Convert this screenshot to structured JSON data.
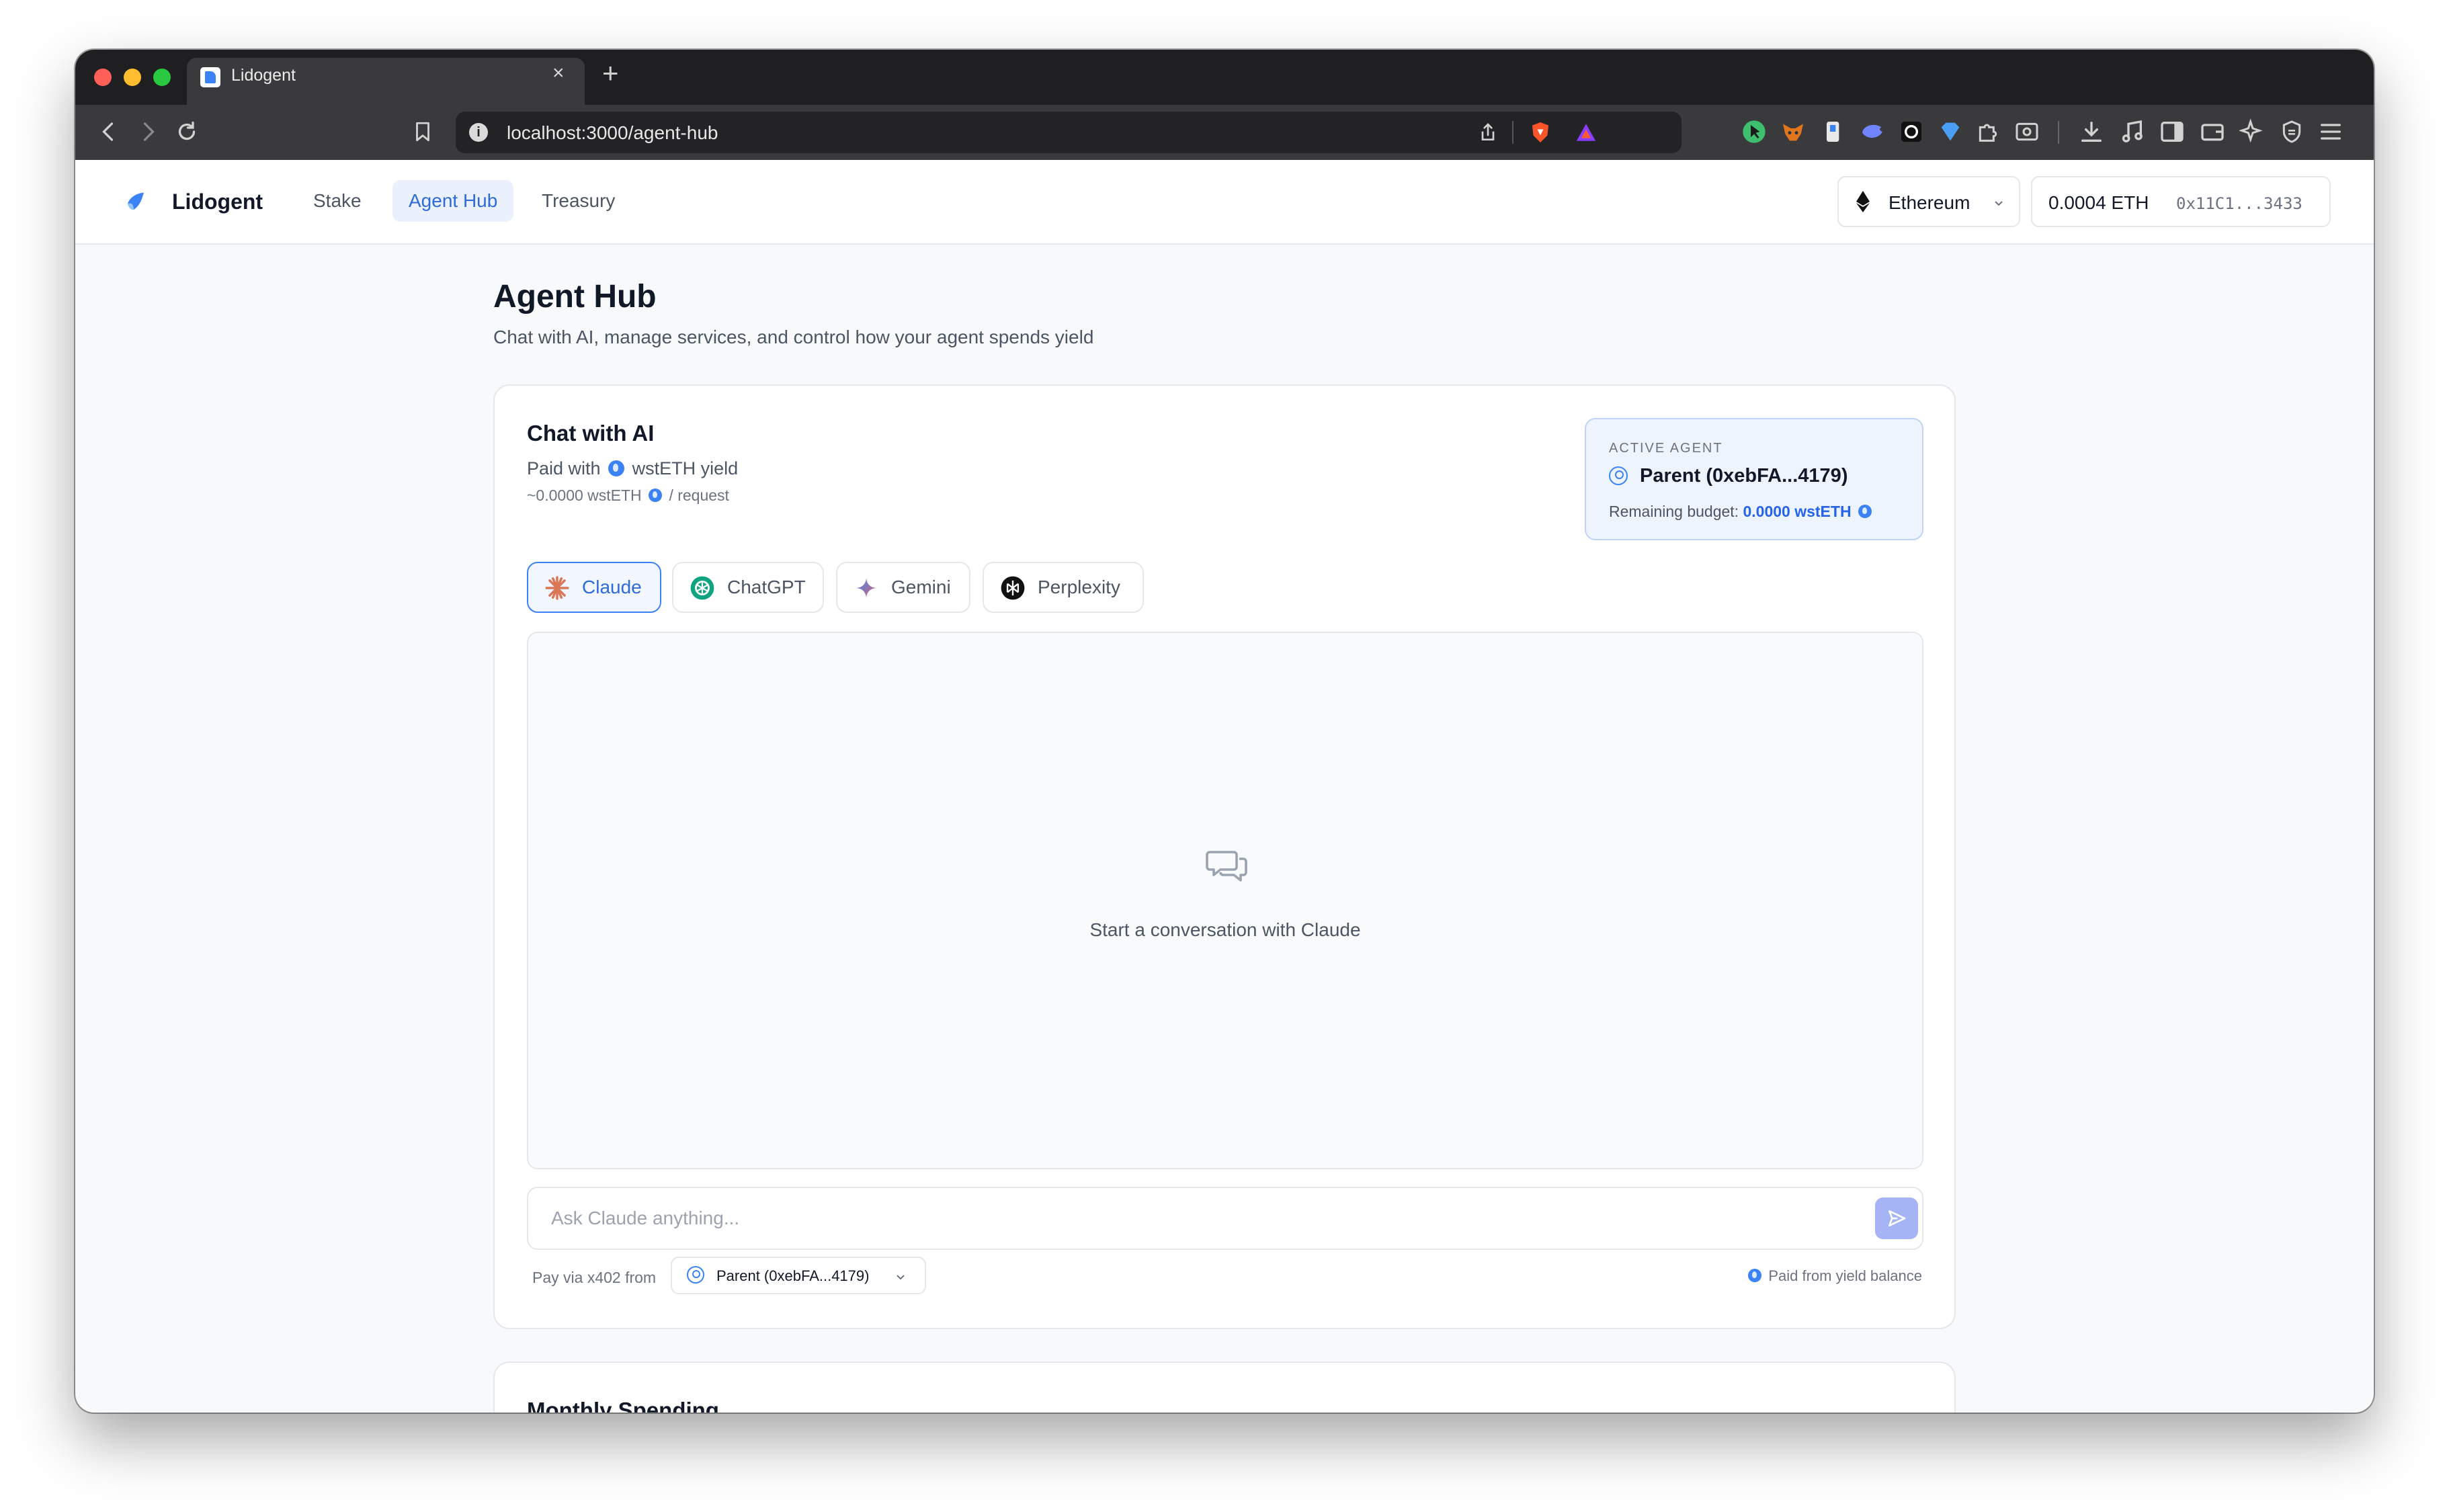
{
  "browser": {
    "tab_title": "Lidogent",
    "tab_close": "×",
    "new_tab": "+",
    "url": "localhost:3000/agent-hub"
  },
  "header": {
    "brand": "Lidogent",
    "nav": [
      {
        "label": "Stake",
        "active": false
      },
      {
        "label": "Agent Hub",
        "active": true
      },
      {
        "label": "Treasury",
        "active": false
      }
    ],
    "network": "Ethereum",
    "balance": "0.0004 ETH",
    "address": "0x11C1...3433"
  },
  "page": {
    "title": "Agent Hub",
    "subtitle": "Chat with AI, manage services, and control how your agent spends yield"
  },
  "chat_card": {
    "title": "Chat with AI",
    "paid_prefix": "Paid with",
    "paid_token": "wstETH yield",
    "cost_amount": "~0.0000 wstETH",
    "cost_suffix": "/ request",
    "active_agent": {
      "kicker": "ACTIVE AGENT",
      "name": "Parent (0xebFA...4179)",
      "budget_label": "Remaining budget:",
      "budget_value": "0.0000 wstETH"
    },
    "models": [
      {
        "label": "Claude",
        "icon": "claude-icon",
        "active": true
      },
      {
        "label": "ChatGPT",
        "icon": "chatgpt-icon",
        "active": false
      },
      {
        "label": "Gemini",
        "icon": "gemini-icon",
        "active": false
      },
      {
        "label": "Perplexity",
        "icon": "perplexity-icon",
        "active": false
      }
    ],
    "empty_state": "Start a conversation with Claude",
    "input_placeholder": "Ask Claude anything...",
    "pay_label": "Pay via x402 from",
    "pay_source": "Parent (0xebFA...4179)",
    "paid_from": "Paid from yield balance"
  },
  "spending_card": {
    "title": "Monthly Spending"
  },
  "colors": {
    "accent": "#2f6bd8",
    "accent_bg": "#eaf1fd",
    "token_blue": "#3b82f6",
    "send_button": "#a5b4f5"
  }
}
